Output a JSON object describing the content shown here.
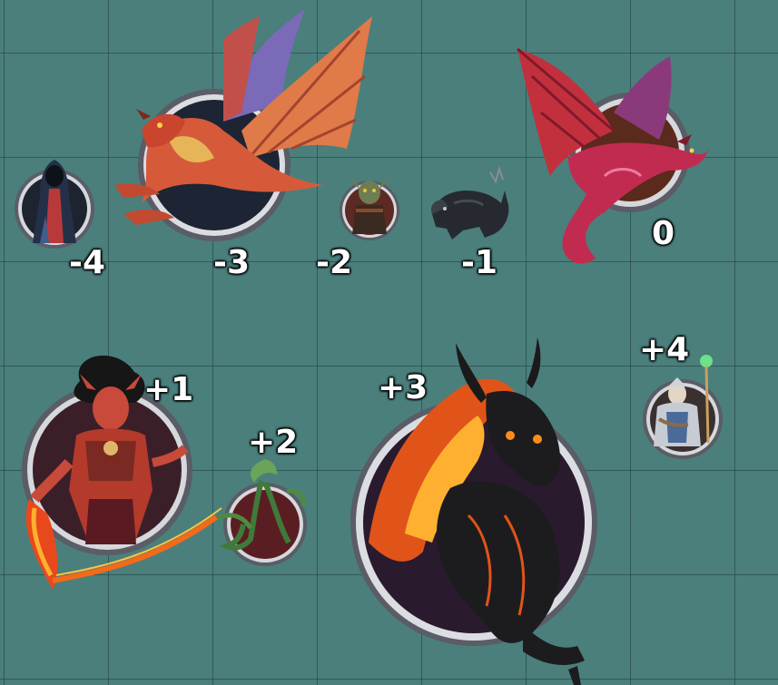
{
  "board": {
    "background_color": "#4a7f7c",
    "grid_color": "#2f5a58"
  },
  "tokens": [
    {
      "id": "cultist",
      "label": "-4",
      "icon": "hooded-cultist-icon"
    },
    {
      "id": "red-dragon",
      "label": "-3",
      "icon": "red-dragon-icon"
    },
    {
      "id": "goblin",
      "label": "-2",
      "icon": "goblin-icon"
    },
    {
      "id": "wolf",
      "label": "-1",
      "icon": "dark-wolf-icon"
    },
    {
      "id": "crimson-dragon",
      "label": "0",
      "icon": "crimson-dragon-icon"
    },
    {
      "id": "fire-woman",
      "label": "+1",
      "icon": "fire-genasi-icon"
    },
    {
      "id": "plant",
      "label": "+2",
      "icon": "vine-creature-icon"
    },
    {
      "id": "nightmare",
      "label": "+3",
      "icon": "nightmare-horse-icon"
    },
    {
      "id": "cleric",
      "label": "+4",
      "icon": "armored-cleric-icon"
    }
  ]
}
